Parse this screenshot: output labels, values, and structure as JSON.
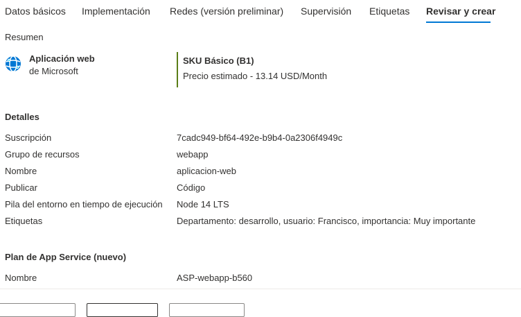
{
  "tabs": [
    {
      "label": "Datos básicos"
    },
    {
      "label": "Implementación"
    },
    {
      "label": "Redes (versión preliminar)"
    },
    {
      "label": "Supervisión"
    },
    {
      "label": "Etiquetas"
    },
    {
      "label": "Revisar y crear"
    }
  ],
  "active_tab": "Revisar y crear",
  "summary": {
    "label": "Resumen",
    "app_name": "Aplicación web",
    "publisher": "de Microsoft",
    "sku_title": "SKU Básico (B1)",
    "sku_price": "Precio estimado - 13.14 USD/Month",
    "icon": "web-app-globe-icon"
  },
  "details": {
    "title": "Detalles",
    "rows": [
      {
        "label": "Suscripción",
        "value": "7cadc949-bf64-492e-b9b4-0a2306f4949c"
      },
      {
        "label": "Grupo de recursos",
        "value": "webapp"
      },
      {
        "label": "Nombre",
        "value": "aplicacion-web"
      },
      {
        "label": "Publicar",
        "value": "Código"
      },
      {
        "label": "Pila del entorno en tiempo de ejecución",
        "value": "Node 14 LTS"
      },
      {
        "label": "Etiquetas",
        "value": "Departamento: desarrollo, usuario: Francisco, importancia: Muy importante"
      }
    ]
  },
  "app_service_plan": {
    "title": "Plan de App Service (nuevo)",
    "rows": [
      {
        "label": "Nombre",
        "value": "ASP-webapp-b560"
      }
    ]
  },
  "colors": {
    "accent": "#0078d4",
    "sku_bar": "#5a7d17",
    "text": "#323130"
  }
}
